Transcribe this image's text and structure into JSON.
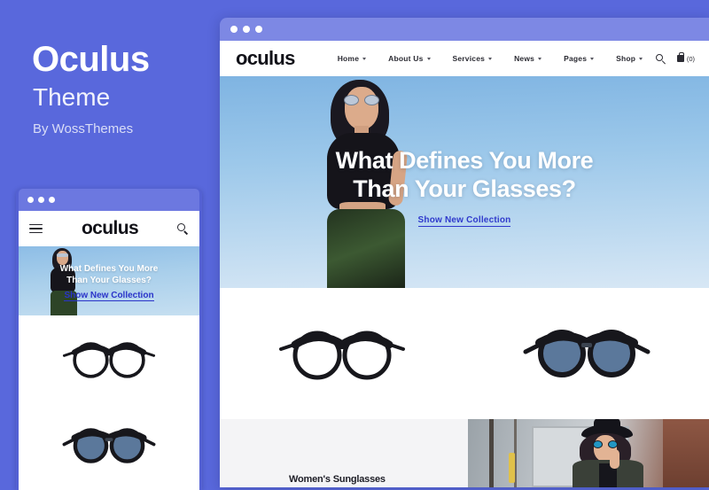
{
  "promo": {
    "title": "Oculus",
    "subtitle": "Theme",
    "byline": "By WossThemes"
  },
  "colors": {
    "background_purple": "#5968dc",
    "titlebar_purple": "#7d88e4",
    "mobile_frame_purple": "#5461d4",
    "cta_blue": "#2f39cc",
    "hero_sky": "#9cc8ea",
    "category_band": "#f4f4f6",
    "text_dark": "#1d1d26"
  },
  "desktop": {
    "titlebar": {
      "dots": [
        "close-dot",
        "minimize-dot",
        "maximize-dot"
      ]
    },
    "header": {
      "logo": "oculus",
      "menu": [
        {
          "label": "Home",
          "has_dropdown": true
        },
        {
          "label": "About Us",
          "has_dropdown": true
        },
        {
          "label": "Services",
          "has_dropdown": true
        },
        {
          "label": "News",
          "has_dropdown": true
        },
        {
          "label": "Pages",
          "has_dropdown": true
        },
        {
          "label": "Shop",
          "has_dropdown": true
        }
      ],
      "search_icon": "search-icon",
      "cart_icon": "shopping-bag-icon",
      "cart_count": "(0)"
    },
    "hero": {
      "heading_line1": "What Defines You More",
      "heading_line2": "Than Your Glasses?",
      "cta": "Show New Collection",
      "image_alt": "woman-in-sunglasses-sky"
    },
    "products": [
      {
        "name": "clear-eyeglasses",
        "lens": "clear"
      },
      {
        "name": "blue-tinted-sunglasses",
        "lens": "blue"
      }
    ],
    "category": {
      "title": "Women's Sunglasses",
      "image_alt": "woman-with-hat-and-blue-sunglasses"
    }
  },
  "mobile": {
    "titlebar": {
      "dots": [
        "close-dot",
        "minimize-dot",
        "maximize-dot"
      ]
    },
    "header": {
      "menu_icon": "hamburger-menu-icon",
      "logo": "oculus",
      "search_icon": "search-icon"
    },
    "hero": {
      "heading_line1": "What Defines You More",
      "heading_line2": "Than Your Glasses?",
      "cta": "Show New Collection"
    },
    "products": [
      {
        "name": "clear-eyeglasses",
        "lens": "clear"
      },
      {
        "name": "blue-tinted-sunglasses",
        "lens": "blue"
      }
    ]
  }
}
